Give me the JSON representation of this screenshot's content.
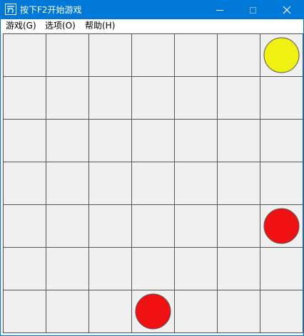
{
  "window": {
    "title": "按下F2开始游戏",
    "accent_color": "#0078d7"
  },
  "title_buttons": {
    "minimize_icon": "minimize-icon",
    "maximize_icon": "maximize-icon",
    "close_icon": "close-icon"
  },
  "menu": {
    "items": [
      {
        "label": "游戏(G)"
      },
      {
        "label": "选项(O)"
      },
      {
        "label": "帮助(H)"
      }
    ]
  },
  "board": {
    "columns": 7,
    "rows": 7,
    "cell_color": "#f0f0f0",
    "grid_color": "#555555",
    "pieces": [
      {
        "row": 0,
        "col": 6,
        "color": "#f0f012",
        "name": "yellow-piece"
      },
      {
        "row": 4,
        "col": 6,
        "color": "#f01212",
        "name": "red-piece"
      },
      {
        "row": 6,
        "col": 3,
        "color": "#f01212",
        "name": "red-piece"
      }
    ]
  }
}
